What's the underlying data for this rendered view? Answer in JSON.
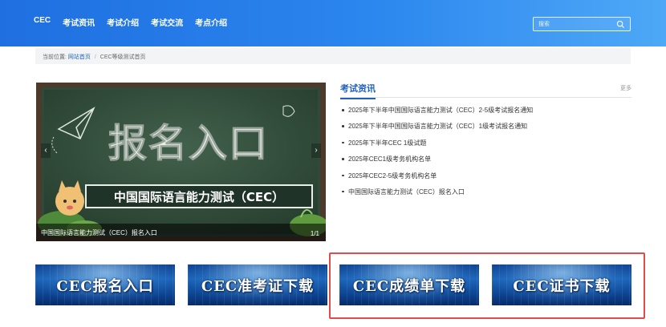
{
  "nav": {
    "items": [
      "CEC",
      "考试资讯",
      "考试介绍",
      "考试交流",
      "考点介绍"
    ],
    "search_placeholder": "搜索"
  },
  "breadcrumb": {
    "prefix": "当前位置:",
    "home": "网站首页",
    "separator": "/",
    "current": "CEC等级测试首页"
  },
  "slider": {
    "image_heading": "报名入口",
    "image_subtitle": "中国国际语言能力测试（CEC）",
    "caption": "中国国际语言能力测试（CEC）报名入口",
    "counter": "1/1",
    "prev": "‹",
    "next": "›"
  },
  "news": {
    "title": "考试资讯",
    "more": "更多",
    "items": [
      "2025年下半年中国国际语言能力测试（CEC）2-5级考试报名通知",
      "2025年下半年中国国际语言能力测试（CEC）1级考试报名通知",
      "2025年下半年CEC 1级试题",
      "2025年CEC1级考务机构名单",
      "2025年CEC2-5级考务机构名单",
      "中国国际语言能力测试（CEC）报名入口"
    ]
  },
  "banners": [
    "CEC报名入口",
    "CEC准考证下载",
    "CEC成绩单下载",
    "CEC证书下载"
  ],
  "colors": {
    "nav_start": "#1f6fe0",
    "nav_end": "#4ea8f7",
    "accent": "#1e5fbf",
    "highlight": "#e24b4b"
  }
}
